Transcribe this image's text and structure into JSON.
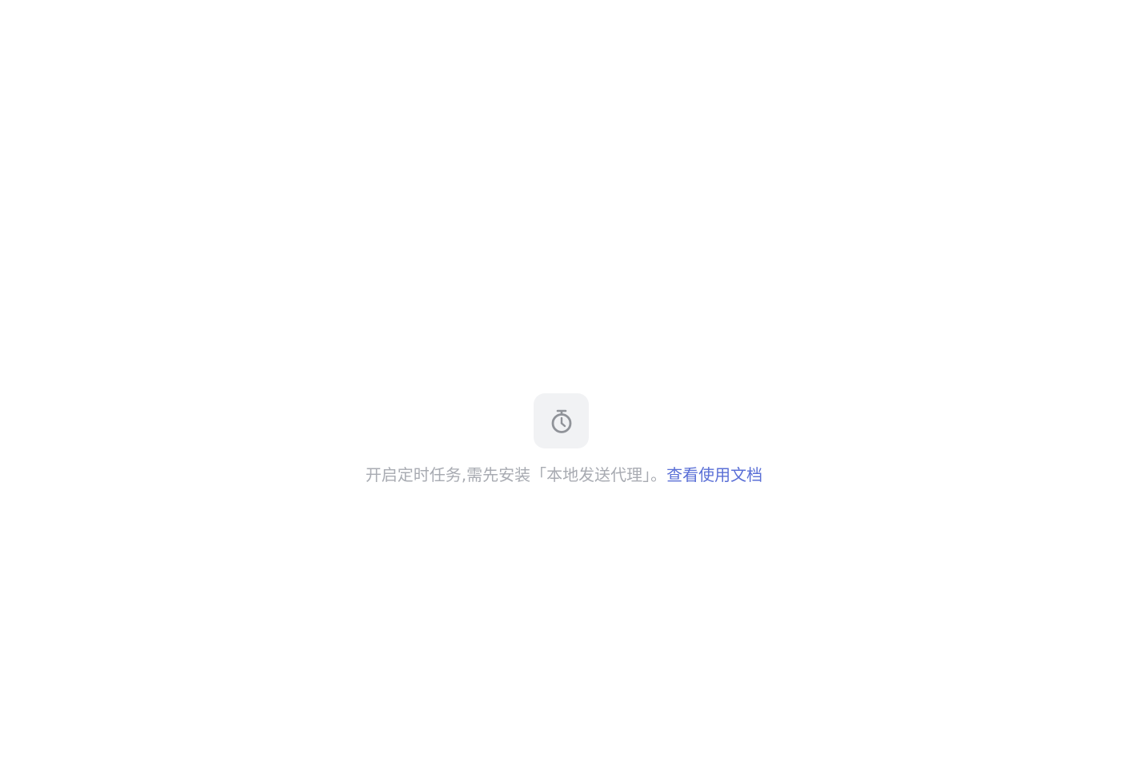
{
  "empty_state": {
    "icon": "stopwatch-icon",
    "message": "开启定时任务,需先安装「本地发送代理」。",
    "link_label": "查看使用文档",
    "colors": {
      "message_text": "#a8abb2",
      "link_text": "#5a6fd6",
      "icon": "#909399",
      "icon_tile_bg": "#f1f2f4",
      "page_bg": "#ffffff"
    }
  }
}
